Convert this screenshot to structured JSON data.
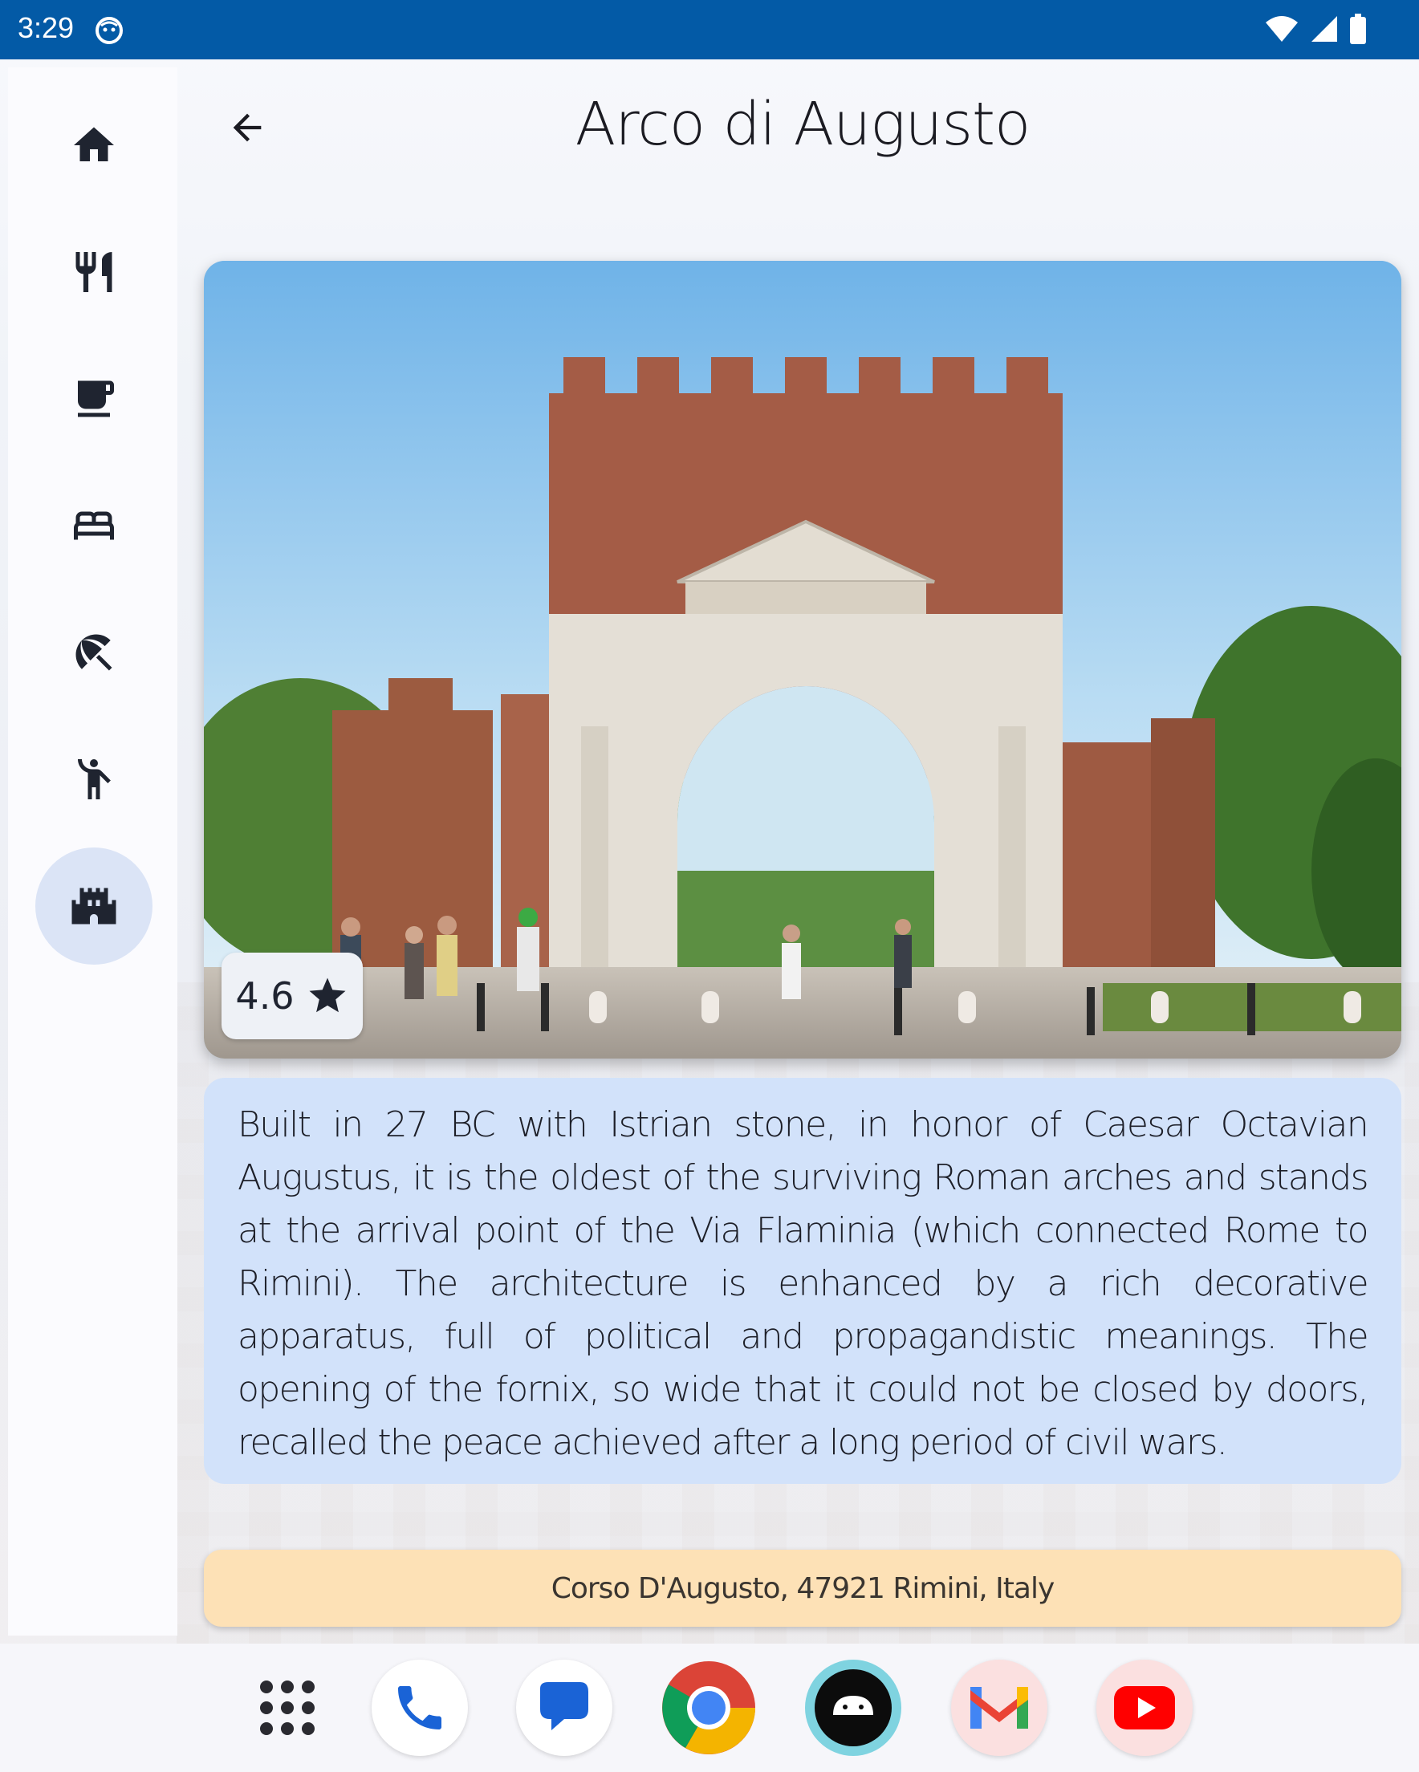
{
  "status_bar": {
    "time": "3:29"
  },
  "nav": {
    "items": [
      {
        "id": "home",
        "icon": "home-icon"
      },
      {
        "id": "restaurants",
        "icon": "restaurant-icon"
      },
      {
        "id": "coffee",
        "icon": "coffee-icon"
      },
      {
        "id": "hotels",
        "icon": "bed-icon"
      },
      {
        "id": "beaches",
        "icon": "beach-umbrella-icon"
      },
      {
        "id": "activities",
        "icon": "person-activity-icon"
      },
      {
        "id": "monuments",
        "icon": "castle-icon",
        "selected": true
      }
    ]
  },
  "header": {
    "title": "Arco di Augusto"
  },
  "place": {
    "rating": "4.6",
    "description": "Built in 27 BC with Istrian stone, in honor of Caesar Octavian Augustus, it is the oldest of the surviving Roman arches and stands at the arrival point of the Via Flaminia (which connected Rome to Rimini). The architecture is enhanced by a rich decorative apparatus, full of political and propagandistic meanings. The opening of the fornix, so wide that it could not be closed by doors, recalled the peace achieved after a long period of civil wars.",
    "address": "Corso D'Augusto, 47921 Rimini, Italy"
  },
  "dock": {
    "apps": [
      "app-drawer-icon",
      "phone-icon",
      "messages-icon",
      "chrome-icon",
      "android-icon",
      "gmail-icon",
      "youtube-icon"
    ]
  },
  "colors": {
    "status_bar": "#035aa6",
    "nav_selected": "#dbe4f6",
    "description_bg": "#d2e2fa",
    "address_bg": "#fde1b6"
  }
}
